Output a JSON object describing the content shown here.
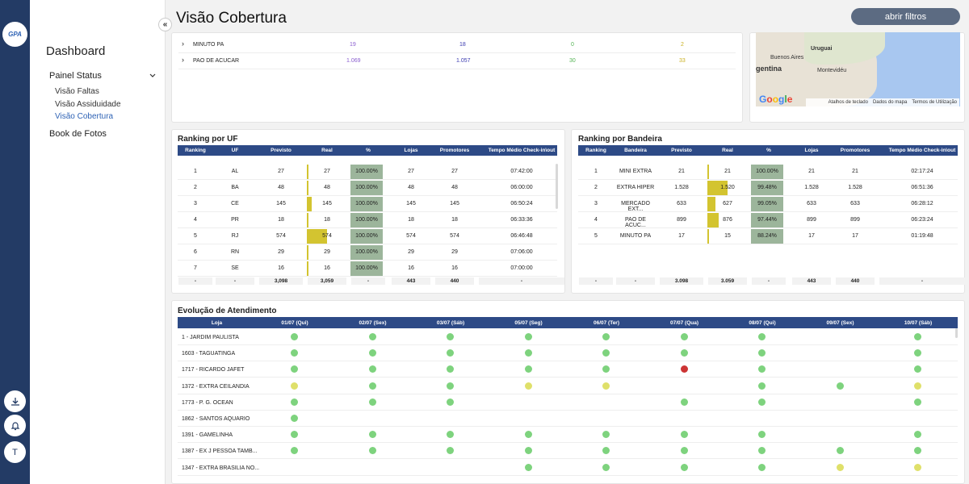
{
  "logo_text": "GPA",
  "page_title": "Visão Cobertura",
  "filter_button": "abrir filtros",
  "sidebar": {
    "title": "Dashboard",
    "status": "Painel Status",
    "subitems": [
      "Visão Faltas",
      "Visão Assiduidade",
      "Visão Cobertura"
    ],
    "book": "Book de Fotos"
  },
  "rail_icons": [
    "download-icon",
    "bell-icon"
  ],
  "user_initial": "T",
  "top_rows": [
    {
      "name": "MINUTO PA",
      "a": "19",
      "b": "18",
      "c": "0",
      "d": "2"
    },
    {
      "name": "PAO DE ACUCAR",
      "a": "1.069",
      "b": "1.057",
      "c": "30",
      "d": "33"
    }
  ],
  "map": {
    "labels": [
      "Uruguai",
      "Buenos Aires",
      "gentina",
      "Montevidéu"
    ],
    "footer": [
      "Atalhos de teclado",
      "Dados do mapa",
      "Termos de Utilização"
    ],
    "google": "Google"
  },
  "colors": {
    "header": "#2d4a86",
    "pct_cell": "#9cb59b",
    "bar": "#d3c430",
    "green": "#7ed37e",
    "yellow": "#dfe06a",
    "red": "#cc3333"
  },
  "ranking_uf": {
    "title": "Ranking por UF",
    "headers": [
      "Ranking",
      "UF",
      "Previsto",
      "Real",
      "%",
      "Lojas",
      "Promotores",
      "Tempo Médio Check-in\\out"
    ],
    "rows": [
      [
        "1",
        "AL",
        "27",
        "27",
        "100.00%",
        "27",
        "27",
        "07:42:00"
      ],
      [
        "2",
        "BA",
        "48",
        "48",
        "100.00%",
        "48",
        "48",
        "06:00:00"
      ],
      [
        "3",
        "CE",
        "145",
        "145",
        "100.00%",
        "145",
        "145",
        "06:50:24"
      ],
      [
        "4",
        "PR",
        "18",
        "18",
        "100.00%",
        "18",
        "18",
        "06:33:36"
      ],
      [
        "5",
        "RJ",
        "574",
        "574",
        "100.00%",
        "574",
        "574",
        "06:46:48"
      ],
      [
        "6",
        "RN",
        "29",
        "29",
        "100.00%",
        "29",
        "29",
        "07:06:00"
      ],
      [
        "7",
        "SE",
        "16",
        "16",
        "100.00%",
        "16",
        "16",
        "07:00:00"
      ]
    ],
    "bar_fraction": [
      0.05,
      0.08,
      0.25,
      0.03,
      1.0,
      0.05,
      0.03
    ],
    "footer": [
      "-",
      "-",
      "3,098",
      "3,059",
      "-",
      "443",
      "440",
      "-"
    ]
  },
  "ranking_bandeira": {
    "title": "Ranking por Bandeira",
    "headers": [
      "Ranking",
      "Bandeira",
      "Previsto",
      "Real",
      "%",
      "Lojas",
      "Promotores",
      "Tempo Médio Check-in\\out"
    ],
    "rows": [
      [
        "1",
        "MINI EXTRA",
        "21",
        "21",
        "100.00%",
        "21",
        "21",
        "02:17:24"
      ],
      [
        "2",
        "EXTRA HIPER",
        "1.528",
        "1.520",
        "99.48%",
        "1.528",
        "1.528",
        "06:51:36"
      ],
      [
        "3",
        "MERCADO EXT...",
        "633",
        "627",
        "99.05%",
        "633",
        "633",
        "06:28:12"
      ],
      [
        "4",
        "PAO DE ACUC...",
        "899",
        "876",
        "97.44%",
        "899",
        "899",
        "06:23:24"
      ],
      [
        "5",
        "MINUTO PA",
        "17",
        "15",
        "88.24%",
        "17",
        "17",
        "01:19:48"
      ]
    ],
    "bar_fraction": [
      0.01,
      1.0,
      0.41,
      0.58,
      0.01
    ],
    "footer": [
      "-",
      "-",
      "3.098",
      "3.059",
      "-",
      "443",
      "440",
      "-"
    ]
  },
  "evolucao": {
    "title": "Evolução de Atendimento",
    "headers": [
      "Loja",
      "01/07 (Qui)",
      "02/07 (Sex)",
      "03/07 (Sáb)",
      "05/07 (Seg)",
      "06/07 (Ter)",
      "07/07 (Qua)",
      "08/07 (Qui)",
      "09/07 (Sex)",
      "10/07 (Sáb)"
    ],
    "rows": [
      {
        "loja": "1 - JARDIM PAULISTA",
        "status": [
          "g",
          "g",
          "g",
          "g",
          "g",
          "g",
          "g",
          "",
          "g"
        ]
      },
      {
        "loja": "1603 - TAGUATINGA",
        "status": [
          "g",
          "g",
          "g",
          "g",
          "g",
          "g",
          "g",
          "",
          "g"
        ]
      },
      {
        "loja": "1717 - RICARDO JAFET",
        "status": [
          "g",
          "g",
          "g",
          "g",
          "g",
          "r",
          "g",
          "",
          "g"
        ]
      },
      {
        "loja": "1372 - EXTRA CEILANDIA",
        "status": [
          "y",
          "g",
          "g",
          "y",
          "y",
          "",
          "g",
          "g",
          "y"
        ]
      },
      {
        "loja": "1773 - P. G. OCEAN",
        "status": [
          "g",
          "g",
          "g",
          "",
          "",
          "g",
          "g",
          "",
          "g"
        ]
      },
      {
        "loja": "1862 - SANTOS AQUARIO",
        "status": [
          "g",
          "",
          "",
          "",
          "",
          "",
          "",
          "",
          ""
        ]
      },
      {
        "loja": "1391 - GAMELINHA",
        "status": [
          "g",
          "g",
          "g",
          "g",
          "g",
          "g",
          "g",
          "",
          "g"
        ]
      },
      {
        "loja": "1387 - EX J PESSOA TAMB...",
        "status": [
          "g",
          "g",
          "g",
          "g",
          "g",
          "g",
          "g",
          "g",
          "g"
        ]
      },
      {
        "loja": "1347 - EXTRA BRASILIA NO...",
        "status": [
          "",
          "",
          "",
          "g",
          "g",
          "g",
          "g",
          "y",
          "y"
        ]
      }
    ]
  }
}
